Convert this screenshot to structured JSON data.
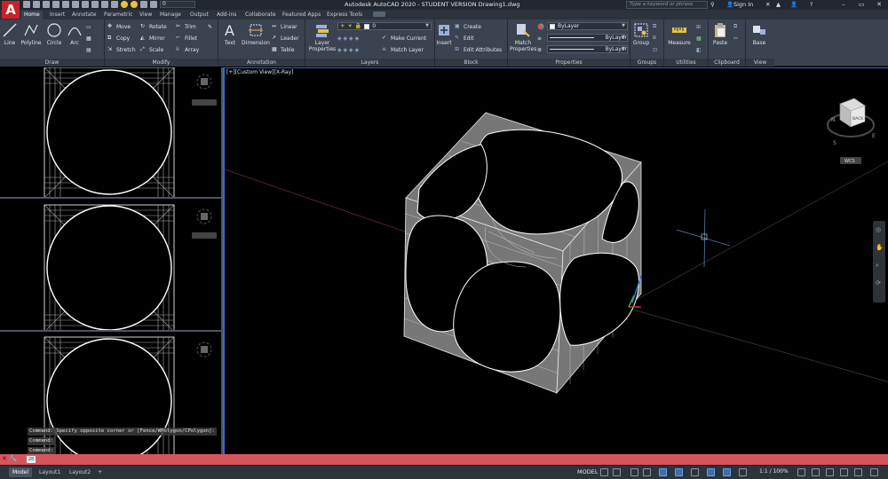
{
  "app": {
    "title": "Autodesk AutoCAD 2020 - STUDENT VERSION    Drawing1.dwg",
    "logo": "A",
    "search_placeholder": "Type a keyword or phrase",
    "sign_in": "Sign In",
    "qat_layer_value": "0"
  },
  "tabs": [
    "Home",
    "Insert",
    "Annotate",
    "Parametric",
    "View",
    "Manage",
    "Output",
    "Add-ins",
    "Collaborate",
    "Featured Apps",
    "Express Tools"
  ],
  "ribbon": {
    "draw": {
      "title": "Draw",
      "line": "Line",
      "polyline": "Polyline",
      "circle": "Circle",
      "arc": "Arc"
    },
    "modify": {
      "title": "Modify",
      "move": "Move",
      "rotate": "Rotate",
      "trim": "Trim",
      "copy": "Copy",
      "mirror": "Mirror",
      "fillet": "Fillet",
      "stretch": "Stretch",
      "scale": "Scale",
      "array": "Array"
    },
    "annotation": {
      "title": "Annotation",
      "text": "Text",
      "dimension": "Dimension",
      "linear": "Linear",
      "leader": "Leader",
      "table": "Table"
    },
    "layers": {
      "title": "Layers",
      "layer_properties": "Layer Properties",
      "layer_value": "0",
      "make_current": "Make Current",
      "match_layer": "Match Layer"
    },
    "block": {
      "title": "Block",
      "insert": "Insert",
      "create": "Create",
      "edit": "Edit",
      "edit_attributes": "Edit Attributes"
    },
    "properties": {
      "title": "Properties",
      "match": "Match Properties",
      "color": "ByLayer",
      "linetype": "ByLayer",
      "lineweight": "ByLayer"
    },
    "groups": {
      "title": "Groups",
      "group": "Group"
    },
    "utilities": {
      "title": "Utilities",
      "measure": "Measure"
    },
    "clipboard": {
      "title": "Clipboard",
      "paste": "Paste"
    },
    "view": {
      "title": "View",
      "base": "Base"
    }
  },
  "viewport": {
    "label": "[+][Custom View][X-Ray]",
    "viewcube_face": "BACK",
    "wcs": "WCS"
  },
  "command": {
    "history": [
      "Command: Specify opposite corner or [Fence/WPolygon/CPolygon]:",
      "Command:",
      "Command:"
    ],
    "prompt_icon": "28"
  },
  "status": {
    "layouts": [
      "Model",
      "Layout1",
      "Layout2"
    ],
    "model": "MODEL",
    "scale": "1:1 / 100%"
  }
}
